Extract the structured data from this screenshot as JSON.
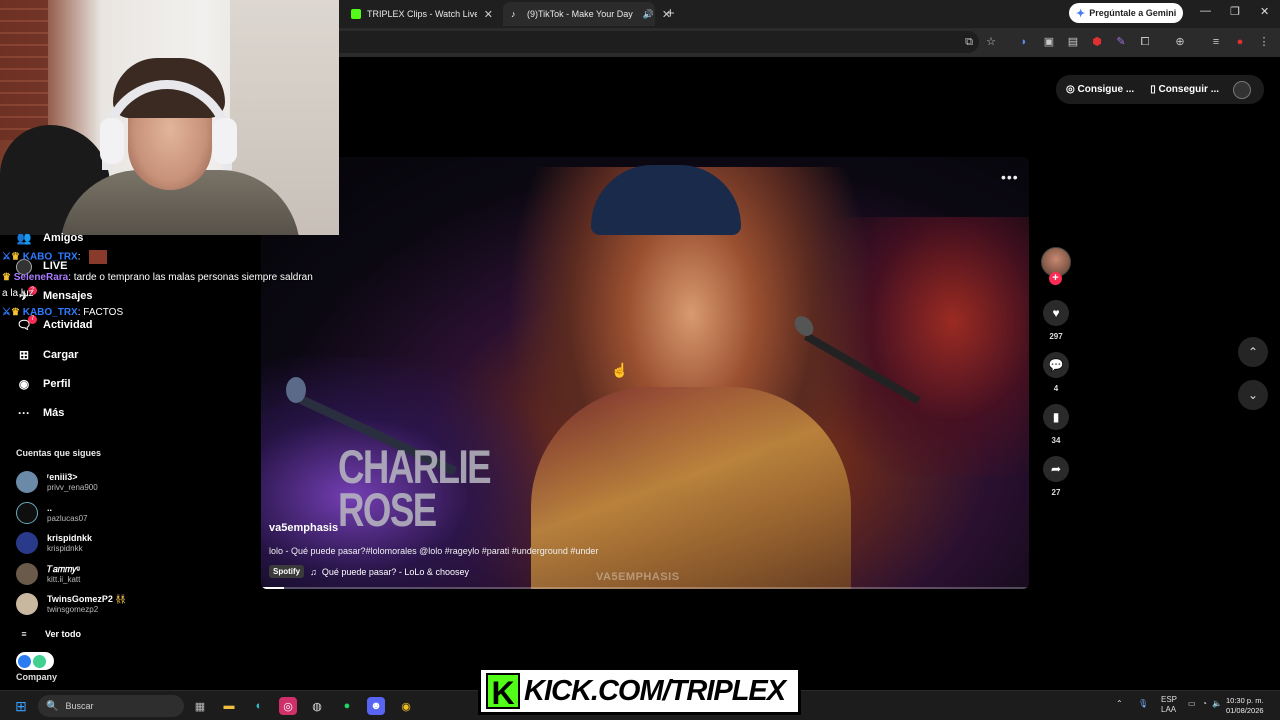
{
  "browser": {
    "tabs": [
      {
        "label": "TRIPLEX Clips - Watch Live on K",
        "favicon_color": "#53fc18"
      },
      {
        "label": "(9)TikTok - Make Your Day",
        "favicon_color": "#ffffff"
      }
    ],
    "gemini_label": "Pregúntale a Gemini"
  },
  "tiktok": {
    "top_buttons": [
      "Consigue ...",
      "Conseguir ..."
    ],
    "video": {
      "username": "va5emphasis",
      "description": "lolo - Qué puede pasar?#lolomorales @lolo #rageylo #parati #underground #under",
      "music_badge": "Spotify",
      "music": "Qué puede pasar? - LoLo & choosey",
      "overlay_text": "CHARLIE ROSE",
      "watermark": "VA5EMPHASIS",
      "progress_fraction": 0.03
    },
    "actions": {
      "likes": "297",
      "comments": "4",
      "saves": "34",
      "shares": "27"
    },
    "nav": [
      {
        "icon": "friends-icon",
        "label": "Amigos"
      },
      {
        "icon": "live-icon",
        "label": "LIVE"
      },
      {
        "icon": "messages-icon",
        "label": "Mensajes"
      },
      {
        "icon": "activity-icon",
        "label": "Actividad"
      },
      {
        "icon": "upload-icon",
        "label": "Cargar"
      },
      {
        "icon": "profile-icon",
        "label": "Perfil"
      },
      {
        "icon": "more-icon",
        "label": "Más"
      }
    ],
    "follows_title": "Cuentas que sigues",
    "follows": [
      {
        "name": "ʳeniii3>",
        "handle": "privv_rena900",
        "color": "#6a8aa8"
      },
      {
        "name": "..",
        "handle": "pazlucas07",
        "color": "#0f0f0f"
      },
      {
        "name": "krispidnkk",
        "handle": "krispidnkk",
        "color": "#2a3a8a"
      },
      {
        "name": "𝑇𝑎𝑚𝑚𝑦ᵍ",
        "handle": "kitt.ii_katt",
        "color": "#6a5a4a"
      },
      {
        "name": "TwinsGomezP2 👯",
        "handle": "twinsgomezp2",
        "color": "#c8b8a0"
      }
    ],
    "see_all": "Ver todo",
    "company": "Company"
  },
  "chat": [
    {
      "user": "KABO_TRX",
      "text": ":",
      "color": "#2e7cff"
    },
    {
      "user": "SeleneRara",
      "text": ": tarde o temprano las malas personas siempre saldran",
      "color": "#a77bff"
    },
    {
      "user": "",
      "text": "a la luz",
      "color": "#ffffff"
    },
    {
      "user": "KABO_TRX",
      "text": ": FACTOS",
      "color": "#2e7cff"
    }
  ],
  "badges": {
    "messages": "2",
    "activity": "7"
  },
  "taskbar": {
    "search_placeholder": "Buscar",
    "lang": "ESP",
    "lang2": "LAA",
    "time": "10:30 p. m.",
    "date": "01/08/2026"
  },
  "overlay": {
    "kick_text": "KICK.COM/TRIPLEX"
  }
}
